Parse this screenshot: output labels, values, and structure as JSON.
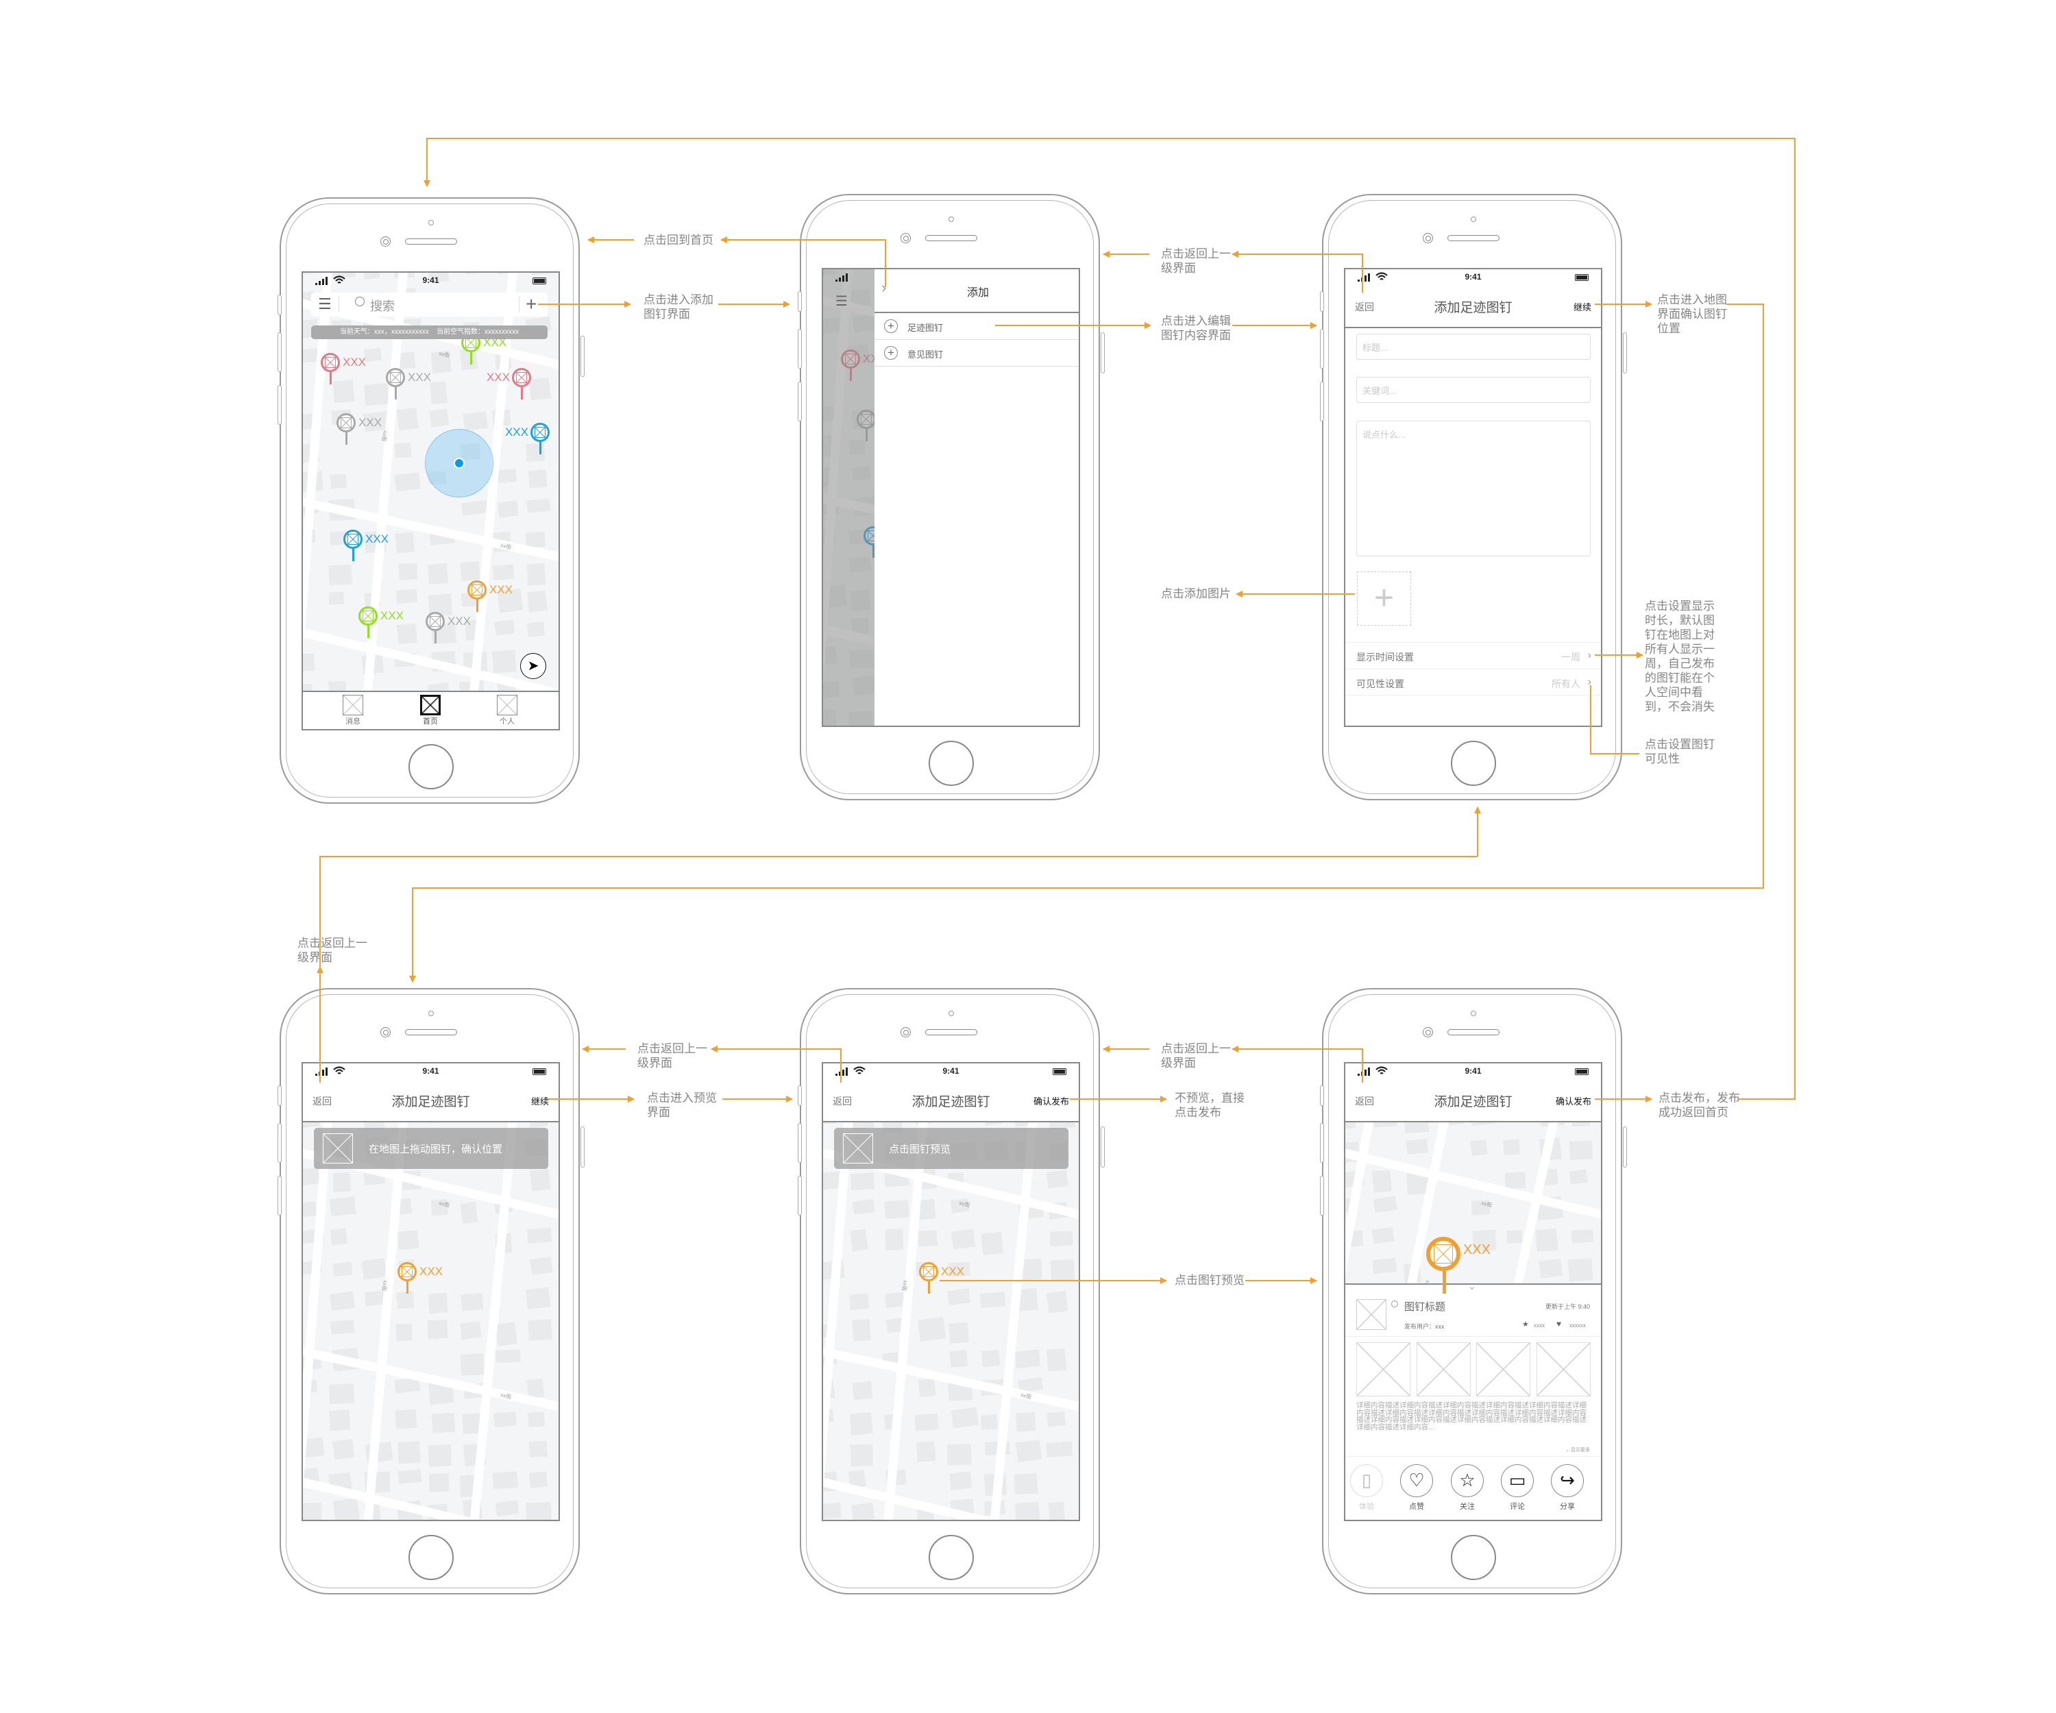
{
  "colors": {
    "flow_arrow": "#f0a030",
    "pin_red": "#e07a86",
    "pin_gray": "#a8a8a8",
    "pin_green": "#8fe01e",
    "pin_blue": "#1ea0e0",
    "pin_orange": "#f0a030",
    "location_dot": "#0a9be8"
  },
  "status_time": "9:41",
  "map": {
    "street_label": "xx街"
  },
  "home": {
    "search_placeholder": "搜索",
    "weather": "当前天气：xxx，xxxxxxxxxxx    当前空气指数：xxxxxxxxxx",
    "pins": [
      {
        "label": "XXX",
        "color": "#e07a86"
      },
      {
        "label": "XXX",
        "color": "#a8a8a8"
      },
      {
        "label": "XXX",
        "color": "#8fe01e"
      },
      {
        "label": "XXX",
        "color": "#e07a86"
      },
      {
        "label": "XXX",
        "color": "#a8a8a8"
      },
      {
        "label": "XXX",
        "color": "#1ea0e0"
      },
      {
        "label": "XXX",
        "color": "#1ea0e0"
      },
      {
        "label": "XXX",
        "color": "#f0a030"
      },
      {
        "label": "XXX",
        "color": "#8fe01e"
      },
      {
        "label": "XXX",
        "color": "#a8a8a8"
      }
    ],
    "tabs": [
      {
        "label": "消息",
        "active": false
      },
      {
        "label": "首页",
        "active": true
      },
      {
        "label": "个人",
        "active": false
      }
    ],
    "icons": [
      "menu-icon",
      "search-icon",
      "plus-icon",
      "locate-icon"
    ]
  },
  "add_menu": {
    "title": "添加",
    "items": [
      {
        "label": "足迹图钉"
      },
      {
        "label": "意见图钉"
      }
    ]
  },
  "edit": {
    "back": "返回",
    "title": "添加足迹图钉",
    "next": "继续",
    "title_placeholder": "标题...",
    "keywords_placeholder": "关键词...",
    "content_placeholder": "说点什么...",
    "settings": [
      {
        "label": "显示时间设置",
        "value": "一周"
      },
      {
        "label": "可见性设置",
        "value": "所有人"
      }
    ]
  },
  "locate": {
    "back": "返回",
    "title": "添加足迹图钉",
    "next": "继续",
    "banner": "在地图上拖动图钉，确认位置",
    "pin_label": "XXX"
  },
  "preview_prompt": {
    "back": "返回",
    "title": "添加足迹图钉",
    "next": "确认发布",
    "banner": "点击图钉预览",
    "pin_label": "XXX"
  },
  "preview": {
    "back": "返回",
    "title": "添加足迹图钉",
    "next": "确认发布",
    "pin_label": "XXX",
    "card_title": "图钉标题",
    "updated": "更新于上午 9:40",
    "publisher": "发布用户：xxx",
    "stars": "xxxx",
    "likes": "xxxxxx",
    "description": "详细内容描述详细内容描述详细内容描述详细内容描述详细内容描述详细内容描述详细内容描述详细内容描述详细内容描述详细内容描述详细内容描述详细内容描述详细内容描述详细内容描述详细内容描述详细内容描述详细内容描述详细内容...",
    "show_more": "显示更多",
    "actions": [
      {
        "label": "体验",
        "icon": "phone-icon"
      },
      {
        "label": "点赞",
        "icon": "heart-icon"
      },
      {
        "label": "关注",
        "icon": "star-icon"
      },
      {
        "label": "评论",
        "icon": "comment-icon"
      },
      {
        "label": "分享",
        "icon": "share-icon"
      }
    ]
  },
  "annotations": {
    "back_home": "点击回到首页",
    "enter_add": "点击进入添加\n图钉界面",
    "back_up_1": "点击返回上一\n级界面",
    "enter_edit": "点击进入编辑\n图钉内容界面",
    "add_image": "点击添加图片",
    "enter_map": "点击进入地图\n界面确认图钉\n位置",
    "display_time": "点击设置显示\n时长，默认图\n钉在地图上对\n所有人显示一\n周，自己发布\n的图钉能在个\n人空间中看\n到，不会消失",
    "visibility": "点击设置图钉\n可见性",
    "back_up_2": "点击返回上一\n级界面",
    "back_up_3": "点击返回上一\n级界面",
    "enter_preview": "点击进入预览\n界面",
    "back_up_4": "点击返回上一\n级界面",
    "direct_publish": "不预览，直接\n点击发布",
    "pin_preview": "点击图钉预览",
    "publish": "点击发布，发布\n成功返回首页"
  }
}
